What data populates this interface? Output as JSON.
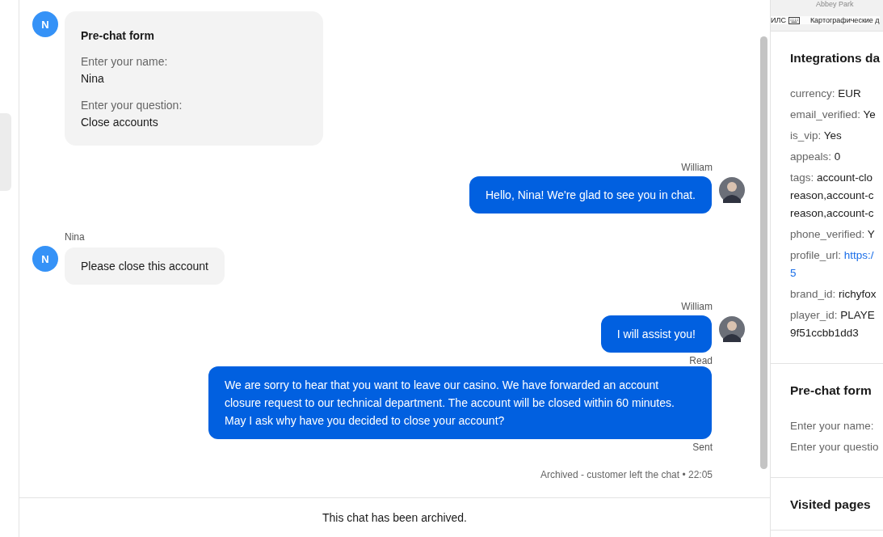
{
  "map": {
    "place": "Abbey Park",
    "short_label": "ИЛС",
    "credit": "Картографические д"
  },
  "chat": {
    "messages": [
      {
        "kind": "form",
        "avatar": "N",
        "title": "Pre-chat form",
        "fields": [
          {
            "label": "Enter your name:",
            "value": "Nina"
          },
          {
            "label": "Enter your question:",
            "value": "Close accounts"
          }
        ]
      },
      {
        "kind": "agent",
        "author": "William",
        "text": "Hello, Nina! We're glad to see you in chat."
      },
      {
        "kind": "customer",
        "author": "Nina",
        "avatar": "N",
        "text": "Please close this account"
      },
      {
        "kind": "agent",
        "author": "William",
        "text": "I will assist you!",
        "status": "Read"
      },
      {
        "kind": "agent",
        "text": "We are sorry to hear that you want to leave our casino. We have forwarded an account closure request to our technical department. The account will be closed within 60 minutes. May I ask why have you decided to close your account?",
        "status": "Sent"
      }
    ],
    "system_note": "Archived - customer left the chat • 22:05",
    "footer": "This chat has been archived."
  },
  "sidebar": {
    "sections": [
      {
        "title": "Integrations da",
        "rows": [
          {
            "key": "currency:",
            "value": [
              "EUR"
            ],
            "kind": "text"
          },
          {
            "key": "email_verified:",
            "value": [
              "Ye"
            ],
            "kind": "text"
          },
          {
            "key": "is_vip:",
            "value": [
              "Yes"
            ],
            "kind": "text"
          },
          {
            "key": "appeals:",
            "value": [
              "0"
            ],
            "kind": "text"
          },
          {
            "key": "tags:",
            "value": [
              "account-clo",
              "reason,account-c",
              "reason,account-c"
            ],
            "kind": "text"
          },
          {
            "key": "phone_verified:",
            "value": [
              "Y"
            ],
            "kind": "text"
          },
          {
            "key": "profile_url:",
            "value": [
              "https:/",
              "5"
            ],
            "kind": "link"
          },
          {
            "key": "brand_id:",
            "value": [
              "richyfox"
            ],
            "kind": "text"
          },
          {
            "key": "player_id:",
            "value": [
              "PLAYE",
              "9f51ccbb1dd3"
            ],
            "kind": "text"
          }
        ]
      },
      {
        "title": "Pre-chat form",
        "rows": [
          {
            "key": "Enter your name:"
          },
          {
            "key": "Enter your questio"
          }
        ]
      },
      {
        "title": "Visited pages"
      }
    ]
  }
}
